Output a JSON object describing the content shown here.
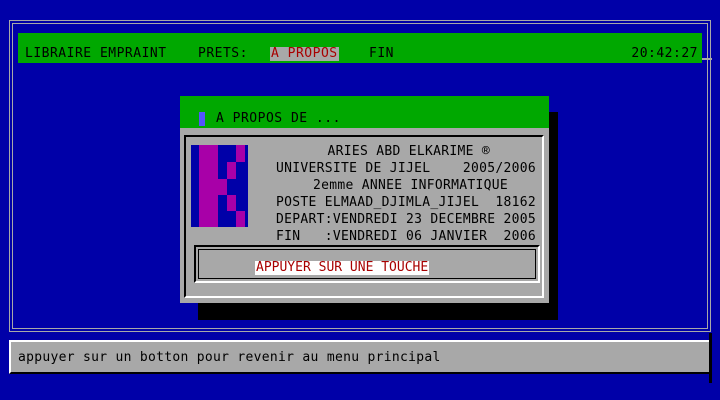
{
  "menubar": {
    "items": [
      {
        "label": "LIBRAIRE EMPRAINT"
      },
      {
        "label": "PRETS:"
      },
      {
        "label": "A PROPOS"
      },
      {
        "label": "FIN"
      }
    ],
    "clock": "20:42:27"
  },
  "dialog": {
    "title": "A PROPOS DE ...",
    "lines": [
      "ARIES ABD ELKARIME ®",
      "UNIVERSITE DE JIJEL    2005/2006",
      "2emme ANNEE INFORMATIQUE",
      "POSTE ELMAAD_DJIMLA_JIJEL  18162",
      "DEPART:VENDREDI 23 DECEMBRE 2005",
      "FIN   :VENDREDI 06 JANVIER  2006"
    ],
    "key_prompt": "APPUYER SUR UNE TOUCHE"
  },
  "statusbar": {
    "text": "appuyer sur un botton pour revenir au menu principal"
  },
  "colors": {
    "background": "#0000a8",
    "menubar": "#00a800",
    "dialog": "#a8a8a8",
    "highlight_text": "#a80000",
    "logo": "#a800a8"
  },
  "icons": {
    "logo": "k-logo-icon",
    "title_box": "window-close-box-icon"
  }
}
